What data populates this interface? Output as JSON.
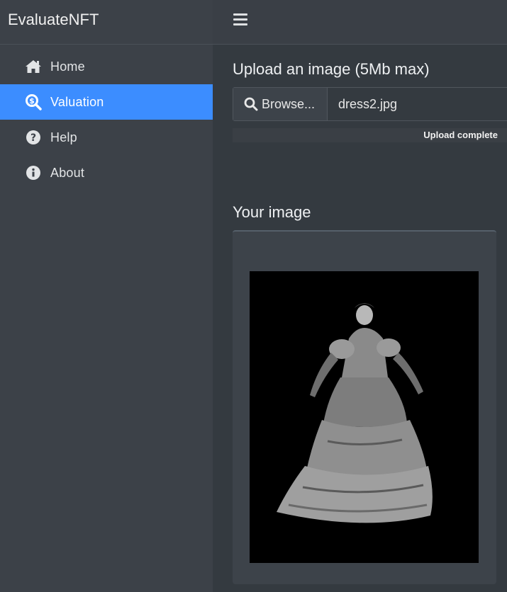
{
  "brand": {
    "title": "EvaluateNFT"
  },
  "sidebar": {
    "items": [
      {
        "label": "Home",
        "icon": "home-icon",
        "active": false
      },
      {
        "label": "Valuation",
        "icon": "search-dollar-icon",
        "active": true
      },
      {
        "label": "Help",
        "icon": "question-circle-icon",
        "active": false
      },
      {
        "label": "About",
        "icon": "info-circle-icon",
        "active": false
      }
    ]
  },
  "header": {
    "menu_icon": "hamburger-icon"
  },
  "upload": {
    "title": "Upload an image (5Mb max)",
    "browse_label": "Browse...",
    "file_name": "dress2.jpg",
    "progress_text": "Upload complete",
    "progress": 1.0
  },
  "image_section": {
    "title": "Your image",
    "image_description_icon": "uploaded-image"
  },
  "colors": {
    "accent": "#3c8dff",
    "sidebar_bg": "#3c4148",
    "main_bg": "#343a40"
  }
}
